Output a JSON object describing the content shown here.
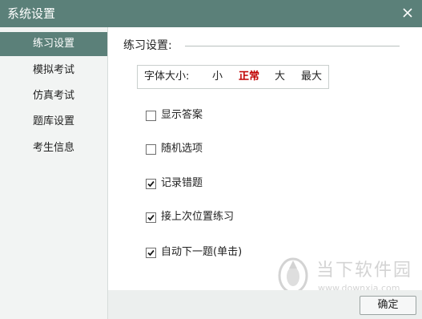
{
  "window": {
    "title": "系统设置",
    "close_icon": "close-icon"
  },
  "sidebar": {
    "items": [
      {
        "label": "练习设置",
        "active": true
      },
      {
        "label": "模拟考试",
        "active": false
      },
      {
        "label": "仿真考试",
        "active": false
      },
      {
        "label": "题库设置",
        "active": false
      },
      {
        "label": "考生信息",
        "active": false
      }
    ]
  },
  "practice": {
    "section_title": "练习设置:",
    "font_size": {
      "label": "字体大小:",
      "options": [
        "小",
        "正常",
        "大",
        "最大"
      ],
      "selected": "正常"
    },
    "options": [
      {
        "label": "显示答案",
        "checked": false
      },
      {
        "label": "随机选项",
        "checked": false
      },
      {
        "label": "记录错题",
        "checked": true
      },
      {
        "label": "接上次位置练习",
        "checked": true
      },
      {
        "label": "自动下一题(单击)",
        "checked": true
      }
    ]
  },
  "footer": {
    "ok_label": "确定"
  },
  "watermark": {
    "name": "当下软件园",
    "url": "www.downxia.com"
  },
  "colors": {
    "accent": "#5b8079",
    "selected_text": "#c00000",
    "sidebar_bg": "#f2f4f3"
  }
}
